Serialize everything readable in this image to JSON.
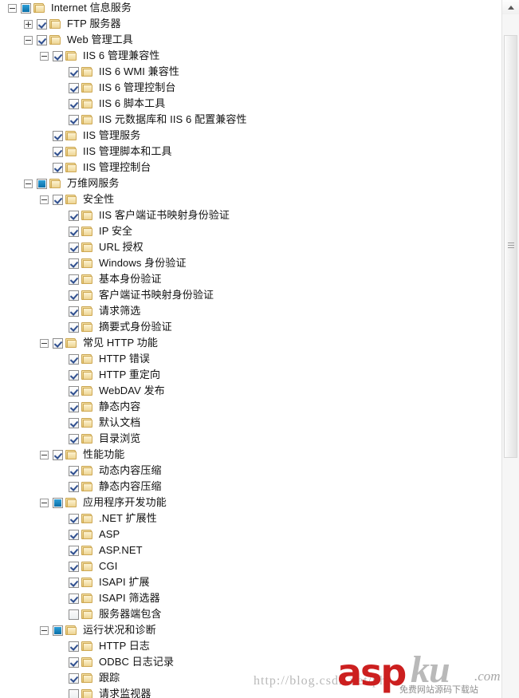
{
  "panel": {
    "name": "windows-features-tree"
  },
  "tree": {
    "nodes": [
      {
        "label": "Internet 信息服务",
        "depth": 0,
        "expander": "minus",
        "check": "partial"
      },
      {
        "label": "FTP 服务器",
        "depth": 1,
        "expander": "plus",
        "check": "checked"
      },
      {
        "label": "Web 管理工具",
        "depth": 1,
        "expander": "minus",
        "check": "checked"
      },
      {
        "label": "IIS 6 管理兼容性",
        "depth": 2,
        "expander": "minus",
        "check": "checked"
      },
      {
        "label": "IIS 6 WMI 兼容性",
        "depth": 3,
        "expander": "none",
        "check": "checked"
      },
      {
        "label": "IIS 6 管理控制台",
        "depth": 3,
        "expander": "none",
        "check": "checked"
      },
      {
        "label": "IIS 6 脚本工具",
        "depth": 3,
        "expander": "none",
        "check": "checked"
      },
      {
        "label": "IIS 元数据库和 IIS 6 配置兼容性",
        "depth": 3,
        "expander": "none",
        "check": "checked"
      },
      {
        "label": "IIS 管理服务",
        "depth": 2,
        "expander": "none",
        "check": "checked"
      },
      {
        "label": "IIS 管理脚本和工具",
        "depth": 2,
        "expander": "none",
        "check": "checked"
      },
      {
        "label": "IIS 管理控制台",
        "depth": 2,
        "expander": "none",
        "check": "checked"
      },
      {
        "label": "万维网服务",
        "depth": 1,
        "expander": "minus",
        "check": "partial"
      },
      {
        "label": "安全性",
        "depth": 2,
        "expander": "minus",
        "check": "checked"
      },
      {
        "label": "IIS 客户端证书映射身份验证",
        "depth": 3,
        "expander": "none",
        "check": "checked"
      },
      {
        "label": "IP 安全",
        "depth": 3,
        "expander": "none",
        "check": "checked"
      },
      {
        "label": "URL 授权",
        "depth": 3,
        "expander": "none",
        "check": "checked"
      },
      {
        "label": "Windows 身份验证",
        "depth": 3,
        "expander": "none",
        "check": "checked"
      },
      {
        "label": "基本身份验证",
        "depth": 3,
        "expander": "none",
        "check": "checked"
      },
      {
        "label": "客户端证书映射身份验证",
        "depth": 3,
        "expander": "none",
        "check": "checked"
      },
      {
        "label": "请求筛选",
        "depth": 3,
        "expander": "none",
        "check": "checked"
      },
      {
        "label": "摘要式身份验证",
        "depth": 3,
        "expander": "none",
        "check": "checked"
      },
      {
        "label": "常见 HTTP 功能",
        "depth": 2,
        "expander": "minus",
        "check": "checked"
      },
      {
        "label": "HTTP 错误",
        "depth": 3,
        "expander": "none",
        "check": "checked"
      },
      {
        "label": "HTTP 重定向",
        "depth": 3,
        "expander": "none",
        "check": "checked"
      },
      {
        "label": "WebDAV 发布",
        "depth": 3,
        "expander": "none",
        "check": "checked"
      },
      {
        "label": "静态内容",
        "depth": 3,
        "expander": "none",
        "check": "checked"
      },
      {
        "label": "默认文档",
        "depth": 3,
        "expander": "none",
        "check": "checked"
      },
      {
        "label": "目录浏览",
        "depth": 3,
        "expander": "none",
        "check": "checked"
      },
      {
        "label": "性能功能",
        "depth": 2,
        "expander": "minus",
        "check": "checked"
      },
      {
        "label": "动态内容压缩",
        "depth": 3,
        "expander": "none",
        "check": "checked"
      },
      {
        "label": "静态内容压缩",
        "depth": 3,
        "expander": "none",
        "check": "checked"
      },
      {
        "label": "应用程序开发功能",
        "depth": 2,
        "expander": "minus",
        "check": "partial"
      },
      {
        "label": ".NET 扩展性",
        "depth": 3,
        "expander": "none",
        "check": "checked"
      },
      {
        "label": "ASP",
        "depth": 3,
        "expander": "none",
        "check": "checked"
      },
      {
        "label": "ASP.NET",
        "depth": 3,
        "expander": "none",
        "check": "checked"
      },
      {
        "label": "CGI",
        "depth": 3,
        "expander": "none",
        "check": "checked"
      },
      {
        "label": "ISAPI 扩展",
        "depth": 3,
        "expander": "none",
        "check": "checked"
      },
      {
        "label": "ISAPI 筛选器",
        "depth": 3,
        "expander": "none",
        "check": "checked"
      },
      {
        "label": "服务器端包含",
        "depth": 3,
        "expander": "none",
        "check": "empty"
      },
      {
        "label": "运行状况和诊断",
        "depth": 2,
        "expander": "minus",
        "check": "partial"
      },
      {
        "label": "HTTP 日志",
        "depth": 3,
        "expander": "none",
        "check": "checked"
      },
      {
        "label": "ODBC 日志记录",
        "depth": 3,
        "expander": "none",
        "check": "checked"
      },
      {
        "label": "跟踪",
        "depth": 3,
        "expander": "none",
        "check": "checked"
      },
      {
        "label": "请求监视器",
        "depth": 3,
        "expander": "none",
        "check": "empty"
      }
    ]
  },
  "scrollbar": {
    "up_arrow": "scroll-up-arrow"
  },
  "watermarks": {
    "url": "http://blog.csdn.net/ph",
    "logo_asp": "asp",
    "logo_ku": "ku",
    "logo_com": ".com",
    "logo_tagline": "免费网站源码下载站"
  }
}
